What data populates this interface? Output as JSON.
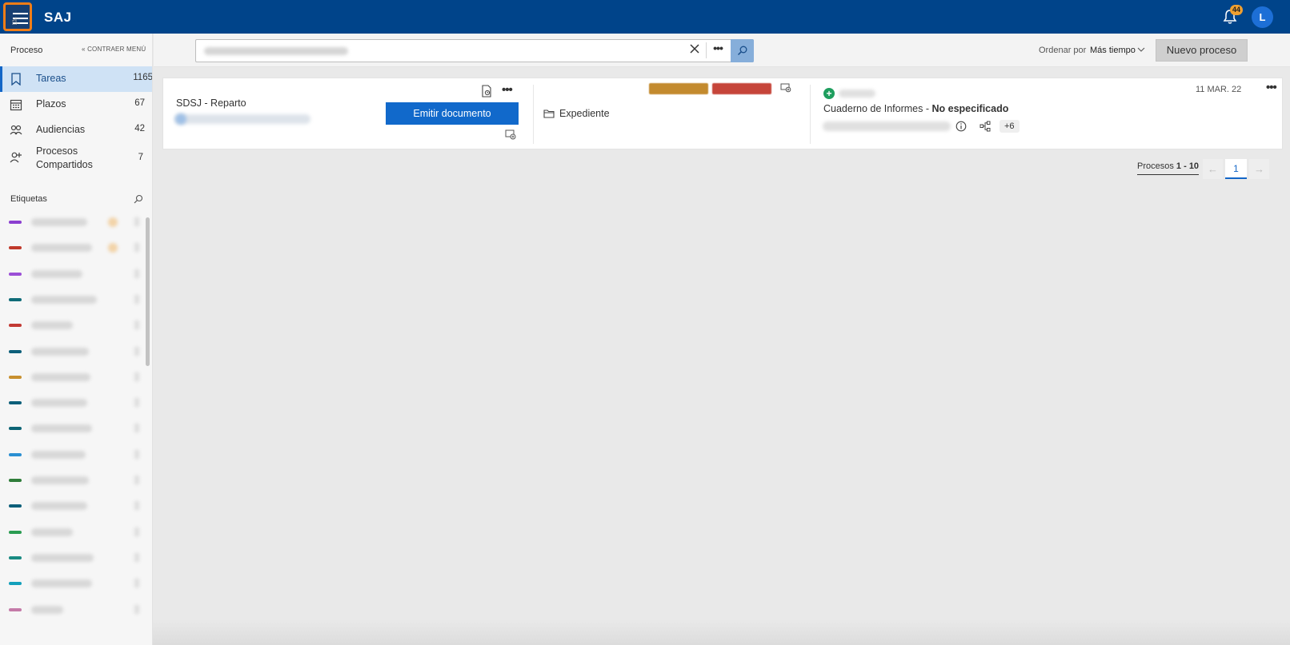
{
  "app": {
    "title": "SAJ",
    "notifications_count": "44",
    "user_initial": "L"
  },
  "sidebar": {
    "section_title": "Proceso",
    "collapse_label": "« CONTRAER MENÚ",
    "items": [
      {
        "label": "Tareas",
        "count": "1165",
        "icon": "bookmark-icon",
        "active": true
      },
      {
        "label": "Plazos",
        "count": "67",
        "icon": "calendar-icon",
        "active": false
      },
      {
        "label": "Audiencias",
        "count": "42",
        "icon": "people-icon",
        "active": false
      },
      {
        "label": "Procesos Compartidos",
        "count": "7",
        "icon": "share-person-icon",
        "active": false
      }
    ],
    "tags_title": "Etiquetas",
    "tag_colors": [
      "#8b3fd0",
      "#c0392b",
      "#9b4fd6",
      "#0f6b78",
      "#c23a34",
      "#0d5f7a",
      "#c8902f",
      "#0d5f7a",
      "#0d6475",
      "#2b8fd2",
      "#2f7d3a",
      "#0d5f7a",
      "#2a9c51",
      "#198a82",
      "#13a0bb",
      "#c47aa8"
    ]
  },
  "search": {
    "clear_icon": "close-icon",
    "more_label": "•••",
    "search_icon": "search-icon"
  },
  "sort": {
    "label": "Ordenar por",
    "value": "Más tiempo"
  },
  "new_process_label": "Nuevo proceso",
  "card": {
    "title": "SDSJ - Reparto",
    "emit_label": "Emitir documento",
    "expediente_label": "Expediente",
    "cuaderno_label": "Cuaderno de Informes - ",
    "cuaderno_value": "No especificado",
    "more_count": "+6",
    "date": "11 MAR. 22",
    "tag_colors": [
      "#c38a2e",
      "#c6453a"
    ]
  },
  "pagination": {
    "label": "Procesos ",
    "range": "1 - 10",
    "current_page": "1",
    "prev": "←",
    "next": "→"
  },
  "colors": {
    "topbar": "#00448a",
    "primary": "#1169cb",
    "active_item": "#cfe2f5",
    "highlight": "#f07d17"
  }
}
